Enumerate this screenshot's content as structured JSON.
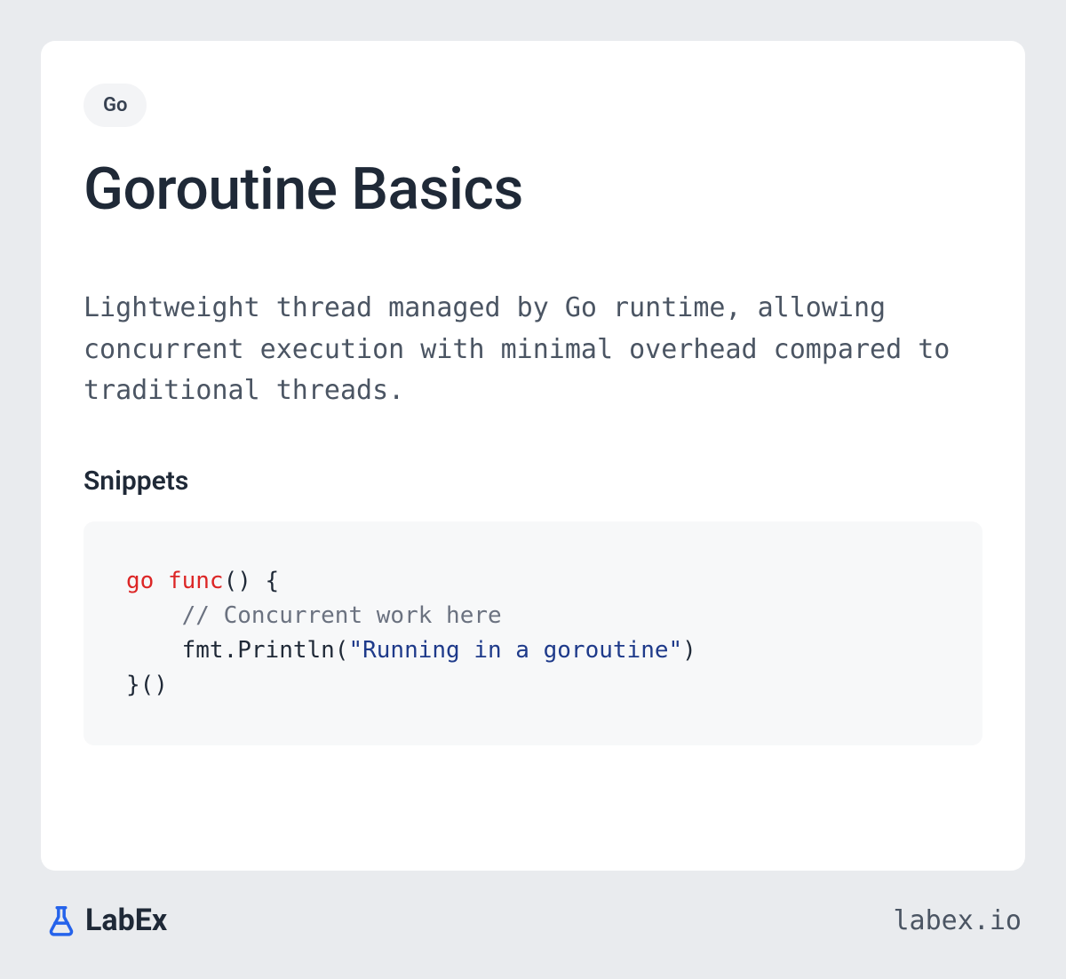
{
  "badge": "Go",
  "title": "Goroutine Basics",
  "description": "Lightweight thread managed by Go runtime, allowing concurrent execution with minimal overhead compared to traditional threads.",
  "snippets_heading": "Snippets",
  "code": {
    "kw1": "go",
    "kw2": "func",
    "l1_rest": "() {",
    "l2_comment": "// Concurrent work here",
    "l3_call": "fmt.Println(",
    "l3_str": "\"Running in a goroutine\"",
    "l3_close": ")",
    "l4": "}()"
  },
  "footer": {
    "brand": "LabEx",
    "url": "labex.io"
  }
}
